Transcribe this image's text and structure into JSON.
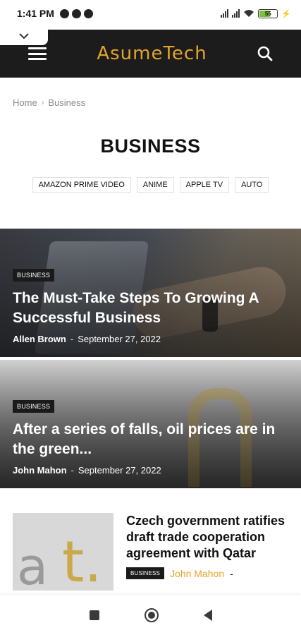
{
  "status_bar": {
    "time": "1:41 PM",
    "battery": "55",
    "icons": [
      "notification-icon",
      "notification-icon",
      "notification-icon",
      "signal-icon",
      "signal-icon",
      "wifi-icon",
      "battery-icon",
      "charging-icon"
    ]
  },
  "header": {
    "logo": "AsumeTech",
    "menu_icon": "hamburger-menu-icon",
    "search_icon": "search-icon",
    "logo_color": "#e2a42b",
    "background": "#1c1c1c"
  },
  "breadcrumb": {
    "home": "Home",
    "separator": "›",
    "current": "Business"
  },
  "page": {
    "title": "BUSINESS"
  },
  "tags": [
    "AMAZON PRIME VIDEO",
    "ANIME",
    "APPLE TV",
    "AUTO"
  ],
  "featured": [
    {
      "badge": "BUSINESS",
      "title": "The Must-Take Steps To Growing A Successful Business",
      "author": "Allen Brown",
      "dash": "-",
      "date": "September 27, 2022"
    },
    {
      "badge": "BUSINESS",
      "title": "After a series of falls, oil prices are in the green...",
      "author": "John Mahon",
      "dash": "-",
      "date": "September 27, 2022"
    }
  ],
  "list": [
    {
      "title": "Czech government ratifies draft trade cooperation agreement with Qatar",
      "badge": "BUSINESS",
      "author": "John Mahon",
      "dash": "-",
      "thumb_text_a": "a",
      "thumb_text_t": "t."
    }
  ]
}
